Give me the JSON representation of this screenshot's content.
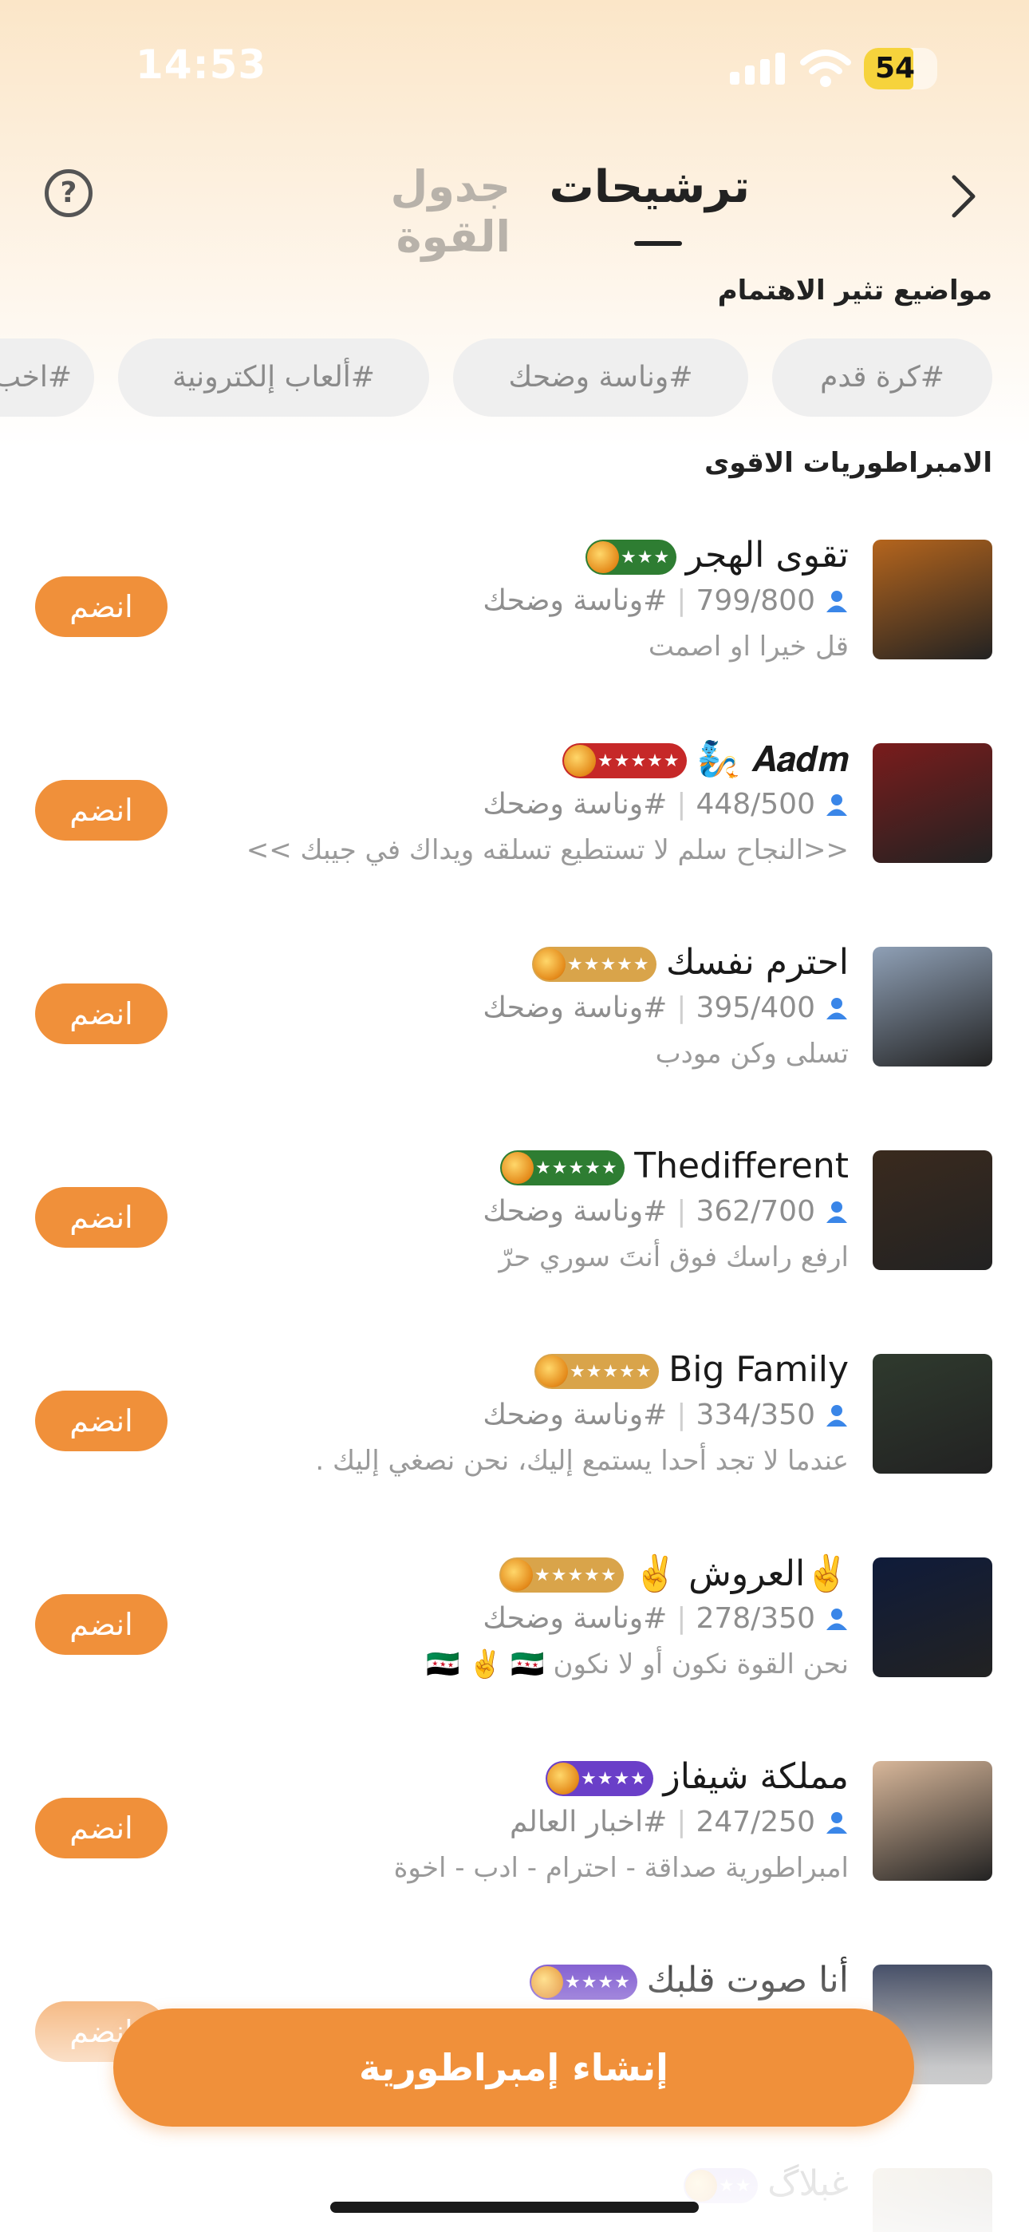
{
  "status_bar": {
    "time": "14:53",
    "battery": "54",
    "signal_icon": "cellular-signal-icon",
    "wifi_icon": "wifi-icon"
  },
  "header": {
    "help_icon": "help-circle-icon",
    "help_glyph": "?",
    "tab_power": "جدول القوة",
    "tab_nominations": "ترشيحات",
    "back_icon": "chevron-right-icon"
  },
  "topics": {
    "title": "مواضيع تثير الاهتمام",
    "chips": [
      "#كرة قدم",
      "#وناسة وضحك",
      "#ألعاب إلكترونية",
      "#اخب"
    ]
  },
  "empires": {
    "title": "الامبراطوريات الاقوى",
    "join_label": "انضم",
    "items": [
      {
        "name": "تقوى الهجر",
        "members": "799/800",
        "tag": "#وناسة وضحك",
        "desc": "قل خيرا او اصمت",
        "badge_color": "#2e7d32",
        "stars": "★★★",
        "avatar_color": "#b5651d"
      },
      {
        "name": "𝑨𝒂𝒅𝒎 🧞",
        "members": "448/500",
        "tag": "#وناسة وضحك",
        "desc": "<<النجاح سلم لا تستطيع تسلقه  ويداك في جيبك >>",
        "badge_color": "#c62828",
        "stars": "★★★★★",
        "avatar_color": "#7a1c1c"
      },
      {
        "name": "احترم نفسك",
        "members": "395/400",
        "tag": "#وناسة وضحك",
        "desc": "تسلى وكن مودب",
        "badge_color": "#d9a44a",
        "stars": "★★★★★",
        "avatar_color": "#8fa0b6"
      },
      {
        "name": "Thedifferent",
        "members": "362/700",
        "tag": "#وناسة وضحك",
        "desc": "ارفع راسك فوق أنتَ سوري حرّ",
        "badge_color": "#2e7d32",
        "stars": "★★★★★",
        "avatar_color": "#3a2a1e"
      },
      {
        "name": "Big Family",
        "members": "334/350",
        "tag": "#وناسة وضحك",
        "desc": "عندما لا تجد أحدا يستمع إليك، نحن نصغي إليك .",
        "badge_color": "#d9a44a",
        "stars": "★★★★★",
        "avatar_color": "#2f3a2e"
      },
      {
        "name": "✌️العروش ✌️",
        "members": "278/350",
        "tag": "#وناسة وضحك",
        "desc": "نحن القوة نكون أو لا نكون 🇸🇾 ✌️ 🇸🇾",
        "badge_color": "#d9a44a",
        "stars": "★★★★★",
        "avatar_color": "#0f1b3a"
      },
      {
        "name": "مملكة شيفاز",
        "members": "247/250",
        "tag": "#اخبار العالم",
        "desc": "امبراطورية صداقة - احترام - ادب - اخوة",
        "badge_color": "#6a3fc8",
        "stars": "★★★★",
        "avatar_color": "#d8b79a"
      },
      {
        "name": "أنا صوت قلبك",
        "members": "",
        "tag": "",
        "desc": "",
        "badge_color": "#6a3fc8",
        "stars": "★★★★",
        "avatar_color": "#1e2a4a"
      },
      {
        "name": "غبلاگ",
        "members": "",
        "tag": "",
        "desc": "",
        "badge_color": "#b9a6e8",
        "stars": "★★",
        "avatar_color": "#c9b38a"
      }
    ]
  },
  "cta": {
    "create_label": "إنشاء إمبراطورية"
  }
}
